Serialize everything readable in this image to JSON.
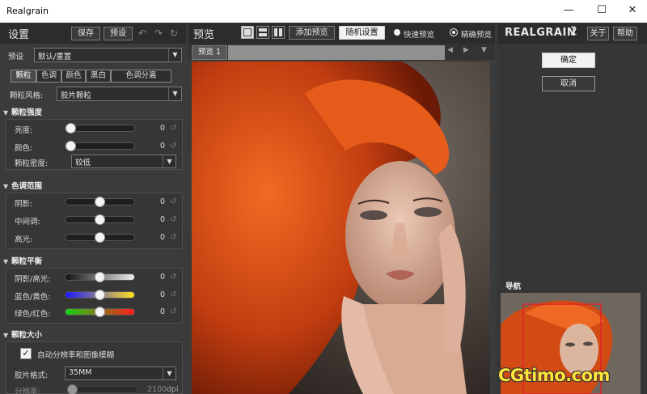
{
  "window": {
    "title": "Realgrain",
    "minimize": "—",
    "maximize": "☐",
    "close": "✕"
  },
  "left": {
    "header_title": "设置",
    "save_label": "保存",
    "preset_label": "预设",
    "preset_row_label": "预设",
    "preset_value": "默认/重置",
    "tabs": [
      "颗粒",
      "色调",
      "颜色",
      "黑白",
      "色调分离"
    ],
    "grain_style_label": "颗粒风格:",
    "grain_style_value": "胶片颗粒",
    "sections": {
      "intensity": "颗粒强度",
      "tone_range": "色调范围",
      "balance": "颗粒平衡",
      "size": "颗粒大小"
    },
    "intensity": {
      "brightness_label": "亮度:",
      "brightness_value": "0",
      "brightness_level": 0.0,
      "color_label": "颜色:",
      "color_value": "0",
      "color_level": 0.0,
      "density_label": "颗粒密度:",
      "density_value": "较低"
    },
    "tone": {
      "shadow_label": "阴影:",
      "shadow_value": "0",
      "shadow_level": 0.5,
      "mid_label": "中间调:",
      "mid_value": "0",
      "mid_level": 0.5,
      "high_label": "高光:",
      "high_value": "0",
      "high_level": 0.5
    },
    "balance": {
      "sh_label": "阴影/高光:",
      "sh_value": "0",
      "sh_level": 0.5,
      "by_label": "蓝色/黄色:",
      "by_value": "0",
      "by_level": 0.5,
      "gr_label": "绿色/红色:",
      "gr_value": "0",
      "gr_level": 0.5
    },
    "size": {
      "auto_checkbox_label": "自动分辨率和图像模糊",
      "auto_checked": true,
      "film_format_label": "胶片格式:",
      "film_format_value": "35MM",
      "resolution_label": "分辨率:",
      "resolution_value": "2100",
      "resolution_unit": "dpi"
    }
  },
  "center": {
    "header_title": "预览",
    "add_preview_label": "添加预览",
    "random_settings_label": "随机设置",
    "quick_preview_label": "快速预览",
    "precise_preview_label": "精确预览",
    "preview_tab_label": "预览 1"
  },
  "right": {
    "logo_main": "REALGRAIN",
    "logo_num": "2",
    "about_label": "关于",
    "help_label": "帮助",
    "ok_label": "确定",
    "cancel_label": "取消",
    "navigator_title": "导航"
  },
  "watermark": "CGtimo.com",
  "colors": {
    "accent": "#e0511c",
    "nav_frame": "#e0212b",
    "watermark": "#ffe23a"
  }
}
